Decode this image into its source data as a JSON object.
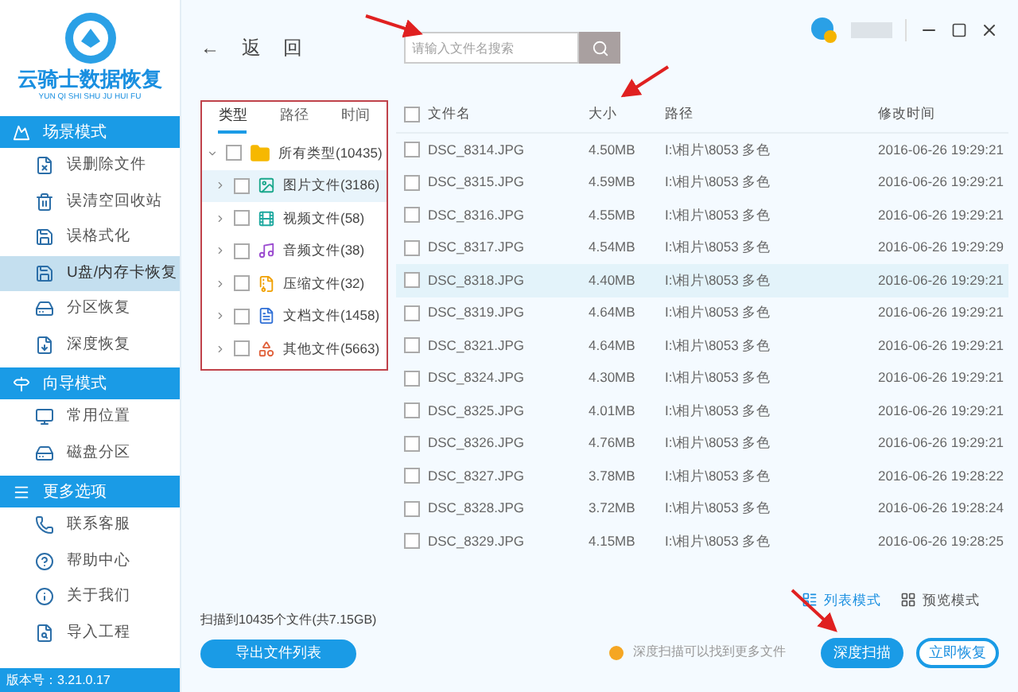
{
  "app": {
    "title": "云骑士数据恢复",
    "subtitle": "YUN QI SHI SHU JU HUI FU"
  },
  "sidebar": {
    "sections": [
      {
        "title": "场景模式",
        "kind": "scene",
        "items": [
          {
            "label": "误删除文件",
            "kind": "file",
            "selected": false
          },
          {
            "label": "误清空回收站",
            "kind": "trash",
            "selected": false
          },
          {
            "label": "误格式化",
            "kind": "save",
            "selected": false
          },
          {
            "label": "U盘/内存卡恢复",
            "kind": "save",
            "selected": true
          },
          {
            "label": "分区恢复",
            "kind": "disk",
            "selected": false
          },
          {
            "label": "深度恢复",
            "kind": "deep",
            "selected": false
          }
        ]
      },
      {
        "title": "向导模式",
        "kind": "guide",
        "items": [
          {
            "label": "常用位置",
            "kind": "monitor",
            "selected": false
          },
          {
            "label": "磁盘分区",
            "kind": "disk",
            "selected": false
          }
        ]
      },
      {
        "title": "更多选项",
        "kind": "more",
        "items": [
          {
            "label": "联系客服",
            "kind": "phone",
            "selected": false
          },
          {
            "label": "帮助中心",
            "kind": "help",
            "selected": false
          },
          {
            "label": "关于我们",
            "kind": "info",
            "selected": false
          },
          {
            "label": "导入工程",
            "kind": "import",
            "selected": false
          }
        ]
      }
    ],
    "version": "版本号：3.21.0.17"
  },
  "toolbar": {
    "back": "←",
    "back_label": "返",
    "back_label_2": "回",
    "search": {
      "placeholder": "请输入文件名搜索"
    }
  },
  "filter": {
    "tabs": [
      {
        "label": "类型",
        "selected": true
      },
      {
        "label": "路径",
        "selected": false
      },
      {
        "label": "时间",
        "selected": false
      }
    ],
    "tree": {
      "label": "所有类型(10435)",
      "kind": "folder",
      "expanded": true,
      "checked": false,
      "children": [
        {
          "label": "图片文件(3186)",
          "kind": "image",
          "checked": false,
          "selected": true
        },
        {
          "label": "视频文件(58)",
          "kind": "video",
          "checked": false,
          "selected": false
        },
        {
          "label": "音频文件(38)",
          "kind": "audio",
          "checked": false,
          "selected": false
        },
        {
          "label": "压缩文件(32)",
          "kind": "zip",
          "checked": false,
          "selected": false
        },
        {
          "label": "文档文件(1458)",
          "kind": "doc",
          "checked": false,
          "selected": false
        },
        {
          "label": "其他文件(5663)",
          "kind": "other",
          "checked": false,
          "selected": false
        }
      ]
    }
  },
  "table": {
    "all_checked": false,
    "columns": [
      "文件名",
      "大小",
      "路径",
      "修改时间"
    ],
    "rows": [
      {
        "cells": [
          "DSC_8314.JPG",
          "4.50MB",
          "I:\\相片\\8053 多色",
          "2016-06-26 19:29:21"
        ],
        "checked": false,
        "selected": false
      },
      {
        "cells": [
          "DSC_8315.JPG",
          "4.59MB",
          "I:\\相片\\8053 多色",
          "2016-06-26 19:29:21"
        ],
        "checked": false,
        "selected": false
      },
      {
        "cells": [
          "DSC_8316.JPG",
          "4.55MB",
          "I:\\相片\\8053 多色",
          "2016-06-26 19:29:21"
        ],
        "checked": false,
        "selected": false
      },
      {
        "cells": [
          "DSC_8317.JPG",
          "4.54MB",
          "I:\\相片\\8053 多色",
          "2016-06-26 19:29:29"
        ],
        "checked": false,
        "selected": false
      },
      {
        "cells": [
          "DSC_8318.JPG",
          "4.40MB",
          "I:\\相片\\8053 多色",
          "2016-06-26 19:29:21"
        ],
        "checked": false,
        "selected": true
      },
      {
        "cells": [
          "DSC_8319.JPG",
          "4.64MB",
          "I:\\相片\\8053 多色",
          "2016-06-26 19:29:21"
        ],
        "checked": false,
        "selected": false
      },
      {
        "cells": [
          "DSC_8321.JPG",
          "4.64MB",
          "I:\\相片\\8053 多色",
          "2016-06-26 19:29:21"
        ],
        "checked": false,
        "selected": false
      },
      {
        "cells": [
          "DSC_8324.JPG",
          "4.30MB",
          "I:\\相片\\8053 多色",
          "2016-06-26 19:29:21"
        ],
        "checked": false,
        "selected": false
      },
      {
        "cells": [
          "DSC_8325.JPG",
          "4.01MB",
          "I:\\相片\\8053 多色",
          "2016-06-26 19:29:21"
        ],
        "checked": false,
        "selected": false
      },
      {
        "cells": [
          "DSC_8326.JPG",
          "4.76MB",
          "I:\\相片\\8053 多色",
          "2016-06-26 19:29:21"
        ],
        "checked": false,
        "selected": false
      },
      {
        "cells": [
          "DSC_8327.JPG",
          "3.78MB",
          "I:\\相片\\8053 多色",
          "2016-06-26 19:28:22"
        ],
        "checked": false,
        "selected": false
      },
      {
        "cells": [
          "DSC_8328.JPG",
          "3.72MB",
          "I:\\相片\\8053 多色",
          "2016-06-26 19:28:24"
        ],
        "checked": false,
        "selected": false
      },
      {
        "cells": [
          "DSC_8329.JPG",
          "4.15MB",
          "I:\\相片\\8053 多色",
          "2016-06-26 19:28:25"
        ],
        "checked": false,
        "selected": false
      }
    ]
  },
  "view_modes": [
    {
      "label": "列表模式",
      "kind": "list",
      "selected": true
    },
    {
      "label": "预览模式",
      "kind": "grid",
      "selected": false
    }
  ],
  "footer": {
    "summary": "扫描到10435个文件(共7.15GB)",
    "export": "导出文件列表",
    "hint": "深度扫描可以找到更多文件",
    "buttons": [
      {
        "label": "深度扫描",
        "kind": "primary"
      },
      {
        "label": "立即恢复",
        "kind": "outline"
      }
    ]
  }
}
